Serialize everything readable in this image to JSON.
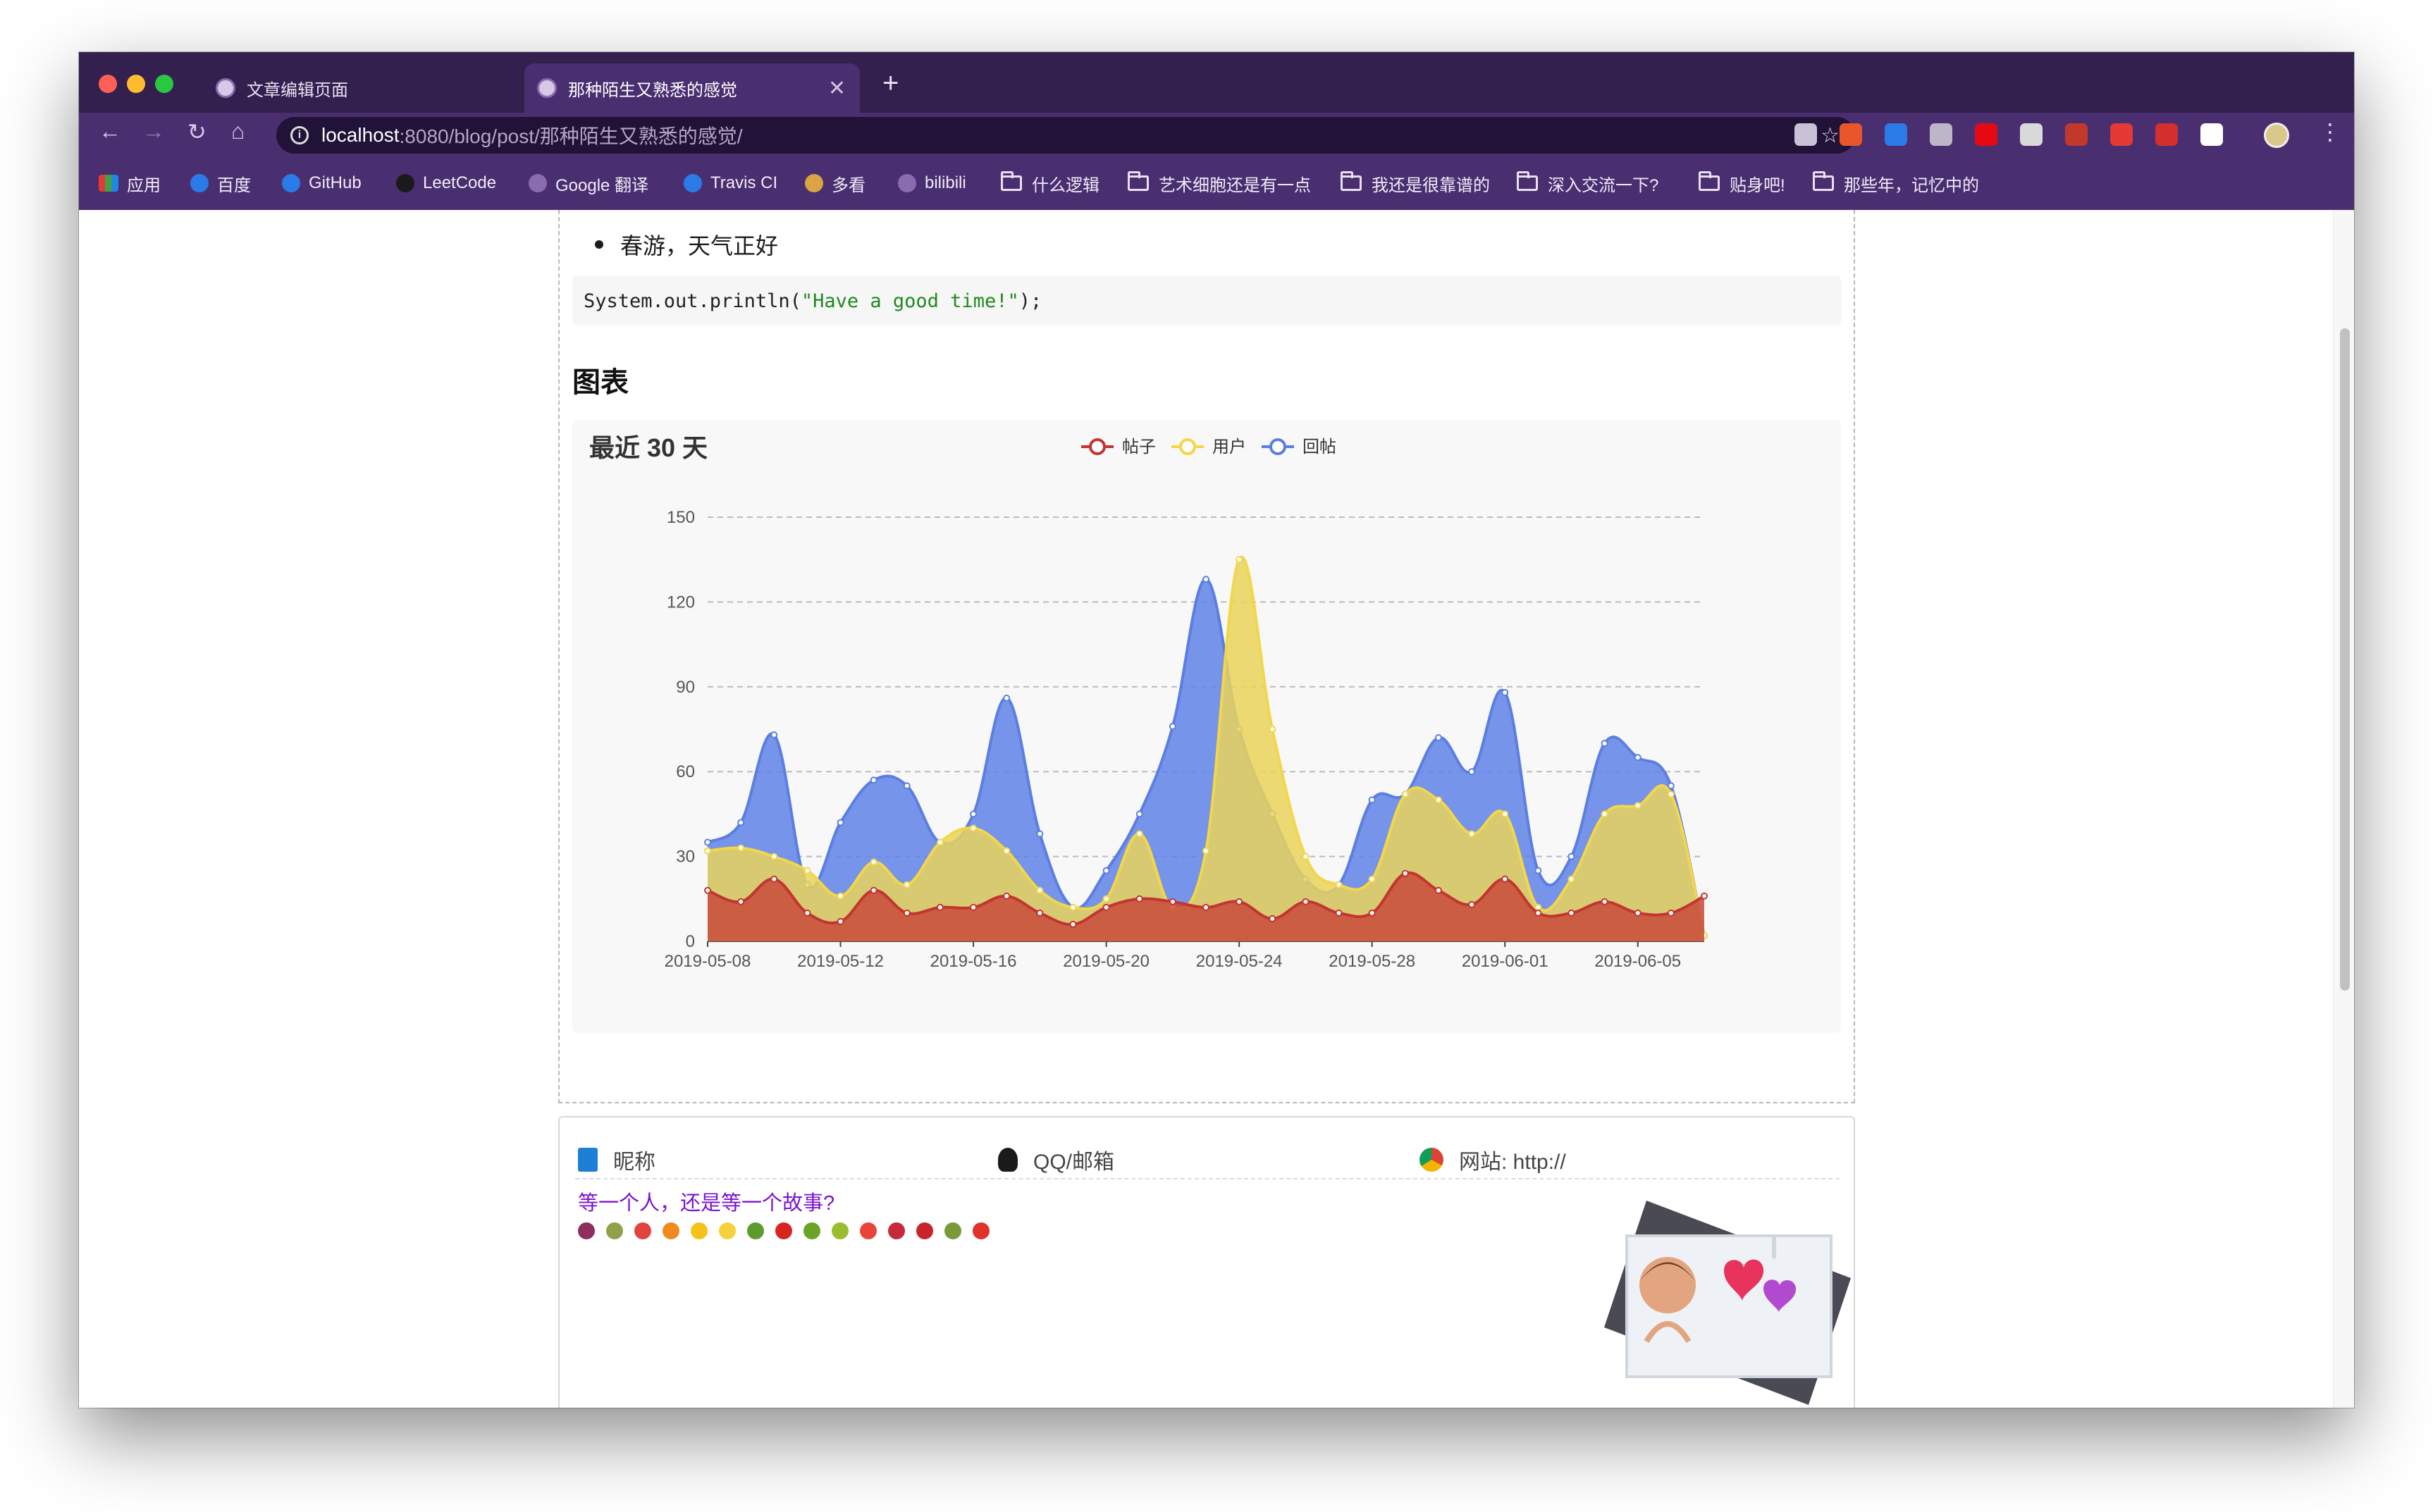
{
  "browser": {
    "tabs": [
      {
        "title": "文章编辑页面",
        "active": false
      },
      {
        "title": "那种陌生又熟悉的感觉",
        "active": true
      }
    ],
    "url_host": "localhost",
    "url_rest": ":8080/blog/post/那种陌生又熟悉的感觉/",
    "bookmarks": [
      {
        "label": "应用",
        "type": "apps"
      },
      {
        "label": "百度",
        "type": "site"
      },
      {
        "label": "GitHub",
        "type": "site"
      },
      {
        "label": "LeetCode",
        "type": "site"
      },
      {
        "label": "Google 翻译",
        "type": "site"
      },
      {
        "label": "Travis CI",
        "type": "site"
      },
      {
        "label": "多看",
        "type": "site"
      },
      {
        "label": "bilibili",
        "type": "site"
      },
      {
        "label": "什么逻辑",
        "type": "folder"
      },
      {
        "label": "艺术细胞还是有一点",
        "type": "folder"
      },
      {
        "label": "我还是很靠谱的",
        "type": "folder"
      },
      {
        "label": "深入交流一下?",
        "type": "folder"
      },
      {
        "label": "贴身吧!",
        "type": "folder"
      },
      {
        "label": "那些年，记忆中的",
        "type": "folder"
      }
    ],
    "extension_colors": [
      "#c9c2d6",
      "#e8562a",
      "#2a7be8",
      "#bdb6c9",
      "#e50914",
      "#d9d9d9",
      "#c0392b",
      "#e53935",
      "#d32f2f",
      "#ffffff"
    ]
  },
  "article": {
    "bullet": "春游，天气正好",
    "code_prefix": "System.out.println(",
    "code_string": "\"Have a good time!\"",
    "code_suffix": ");",
    "heading": "图表"
  },
  "chart_data": {
    "type": "area",
    "title": "最近 30 天",
    "legend_position": "top-center",
    "smooth": true,
    "stacked": false,
    "ylim": [
      0,
      150
    ],
    "yticks": [
      0,
      30,
      60,
      90,
      120,
      150
    ],
    "x": [
      "2019-05-08",
      "2019-05-09",
      "2019-05-10",
      "2019-05-11",
      "2019-05-12",
      "2019-05-13",
      "2019-05-14",
      "2019-05-15",
      "2019-05-16",
      "2019-05-17",
      "2019-05-18",
      "2019-05-19",
      "2019-05-20",
      "2019-05-21",
      "2019-05-22",
      "2019-05-23",
      "2019-05-24",
      "2019-05-25",
      "2019-05-26",
      "2019-05-27",
      "2019-05-28",
      "2019-05-29",
      "2019-05-30",
      "2019-05-31",
      "2019-06-01",
      "2019-06-02",
      "2019-06-03",
      "2019-06-04",
      "2019-06-05",
      "2019-06-06",
      "2019-06-07"
    ],
    "xtick_labels": [
      "2019-05-08",
      "2019-05-12",
      "2019-05-16",
      "2019-05-20",
      "2019-05-24",
      "2019-05-28",
      "2019-06-01",
      "2019-06-05"
    ],
    "series": [
      {
        "name": "帖子",
        "color": "#c23531",
        "fill": "#c94a3a",
        "values": [
          18,
          14,
          22,
          10,
          7,
          18,
          10,
          12,
          12,
          16,
          10,
          6,
          12,
          15,
          14,
          12,
          14,
          8,
          14,
          10,
          10,
          24,
          18,
          13,
          22,
          10,
          10,
          14,
          10,
          10,
          16
        ]
      },
      {
        "name": "用户",
        "color": "#f2d64b",
        "fill": "#ead35a",
        "values": [
          32,
          33,
          30,
          25,
          16,
          28,
          20,
          35,
          40,
          32,
          18,
          12,
          15,
          38,
          12,
          32,
          135,
          75,
          30,
          20,
          22,
          52,
          50,
          38,
          45,
          12,
          22,
          45,
          48,
          52,
          2
        ]
      },
      {
        "name": "回帖",
        "color": "#5b7ee3",
        "fill": "#5f82e6",
        "values": [
          35,
          42,
          73,
          20,
          42,
          57,
          55,
          35,
          45,
          86,
          38,
          12,
          25,
          45,
          76,
          128,
          75,
          45,
          22,
          20,
          50,
          52,
          72,
          60,
          88,
          25,
          30,
          70,
          65,
          55,
          2
        ]
      }
    ]
  },
  "comment": {
    "nickname_placeholder": "昵称",
    "contact_placeholder": "QQ/邮箱",
    "website_placeholder": "网站: http://",
    "textarea_placeholder": "等一个人，还是等一个故事?",
    "emoji_colors": [
      "#8e2f5f",
      "#8fa24a",
      "#e0443c",
      "#f08a1c",
      "#f5c21a",
      "#f5d23b",
      "#5c9b2e",
      "#d8241f",
      "#6aa326",
      "#9abd2f",
      "#e8443a",
      "#c42a3b",
      "#c9242c",
      "#7a9a3a",
      "#e0322b"
    ]
  }
}
